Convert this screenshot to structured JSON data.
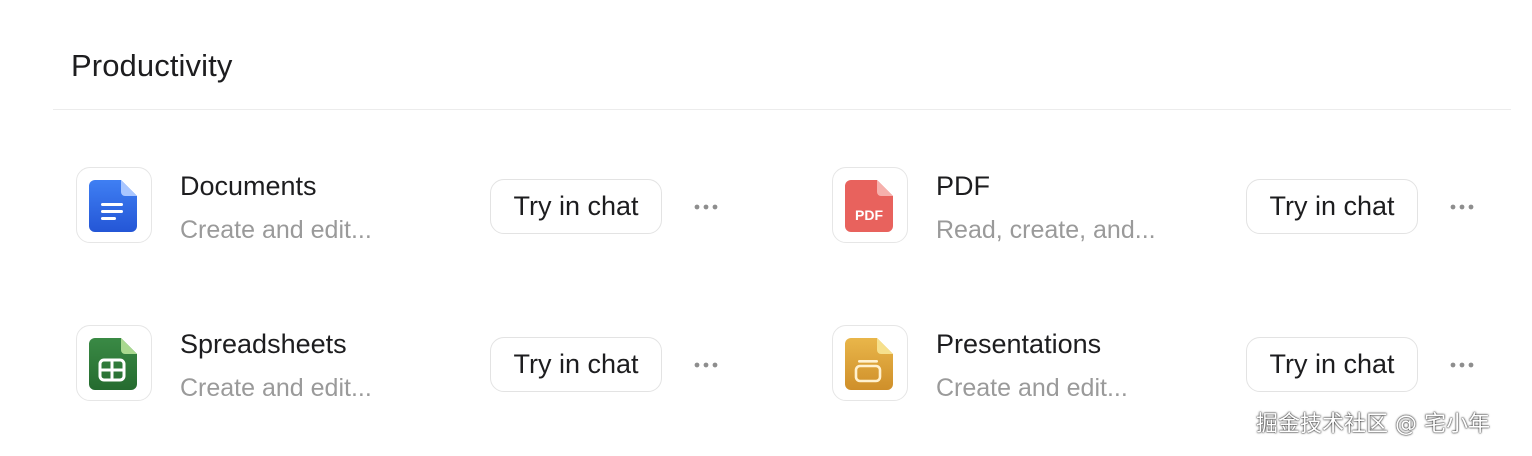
{
  "section": {
    "title": "Productivity"
  },
  "cards": [
    {
      "name": "Documents",
      "description": "Create and edit...",
      "icon": "documents-icon",
      "icon_color": "#2f67e6",
      "button_label": "Try in chat"
    },
    {
      "name": "PDF",
      "description": "Read, create, and...",
      "icon": "pdf-icon",
      "icon_color": "#e8625d",
      "icon_text": "PDF",
      "button_label": "Try in chat"
    },
    {
      "name": "Spreadsheets",
      "description": "Create and edit...",
      "icon": "spreadsheet-icon",
      "icon_color": "#2f7d3a",
      "button_label": "Try in chat"
    },
    {
      "name": "Presentations",
      "description": "Create and edit...",
      "icon": "presentation-icon",
      "icon_color": "#e0a93a",
      "button_label": "Try in chat"
    }
  ],
  "watermark": {
    "text": "掘金技术社区 @ 宅小年"
  }
}
